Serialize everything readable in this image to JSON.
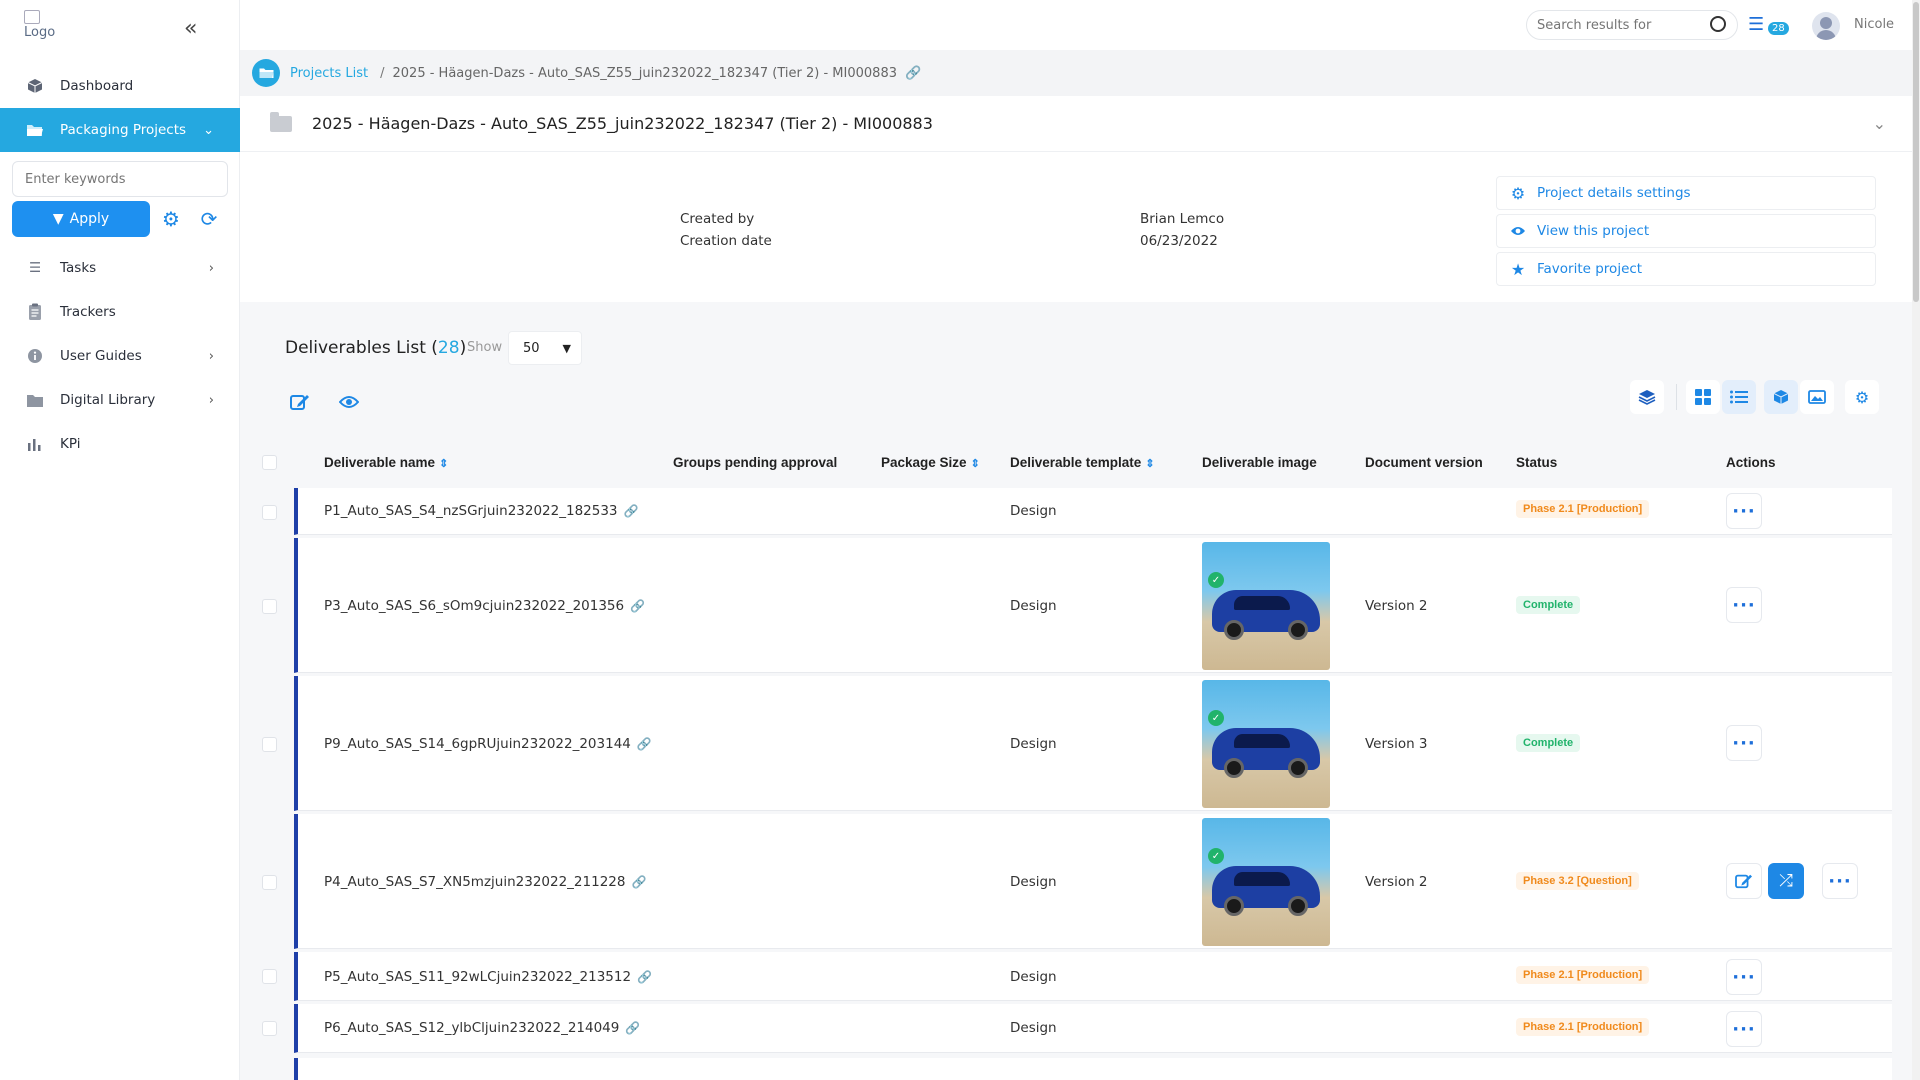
{
  "sidebar": {
    "logo_alt": "Logo",
    "items": [
      {
        "label": "Dashboard",
        "icon": "box-icon",
        "has_chevron": false
      },
      {
        "label": "Packaging Projects",
        "icon": "folder-open-icon",
        "has_chevron": true,
        "active": true
      },
      {
        "label": "Tasks",
        "icon": "list-icon",
        "has_chevron": true
      },
      {
        "label": "Trackers",
        "icon": "clipboard-icon",
        "has_chevron": false
      },
      {
        "label": "User Guides",
        "icon": "info-icon",
        "has_chevron": true
      },
      {
        "label": "Digital Library",
        "icon": "folder-icon",
        "has_chevron": true
      },
      {
        "label": "KPi",
        "icon": "bar-chart-icon",
        "has_chevron": false
      }
    ],
    "filter": {
      "placeholder": "Enter keywords",
      "apply_label": "Apply"
    }
  },
  "topbar": {
    "search_placeholder": "Search results for",
    "notification_count": "28",
    "username": "Nicole"
  },
  "breadcrumb": {
    "root": "Projects List",
    "separator": "/",
    "current": "2025 - Häagen-Dazs - Auto_SAS_Z55_juin232022_182347 (Tier 2) - MI000883"
  },
  "project": {
    "title": "2025 - Häagen-Dazs - Auto_SAS_Z55_juin232022_182347 (Tier 2) - MI000883",
    "created_by_label": "Created by",
    "created_by_value": "Brian Lemco",
    "creation_date_label": "Creation date",
    "creation_date_value": "06/23/2022",
    "actions": [
      {
        "label": "Project details settings",
        "icon": "gear-icon"
      },
      {
        "label": "View this project",
        "icon": "eye-icon"
      },
      {
        "label": "Favorite project",
        "icon": "star-icon"
      }
    ]
  },
  "deliverables": {
    "title": "Deliverables List",
    "count": "28",
    "show_label": "Show",
    "page_size": "50",
    "columns": [
      "Deliverable name",
      "Groups pending approval",
      "Package Size",
      "Deliverable template",
      "Deliverable image",
      "Document version",
      "Status",
      "Actions"
    ],
    "rows": [
      {
        "name": "P1_Auto_SAS_S4_nzSGrjuin232022_182533",
        "template": "Design",
        "version": "",
        "status": "Phase 2.1 [Production]",
        "status_type": "production",
        "has_image": false,
        "extra_actions": false
      },
      {
        "name": "P3_Auto_SAS_S6_sOm9cjuin232022_201356",
        "template": "Design",
        "version": "Version 2",
        "status": "Complete",
        "status_type": "complete",
        "has_image": true,
        "extra_actions": false
      },
      {
        "name": "P9_Auto_SAS_S14_6gpRUjuin232022_203144",
        "template": "Design",
        "version": "Version 3",
        "status": "Complete",
        "status_type": "complete",
        "has_image": true,
        "extra_actions": false
      },
      {
        "name": "P4_Auto_SAS_S7_XN5mzjuin232022_211228",
        "template": "Design",
        "version": "Version 2",
        "status": "Phase 3.2 [Question]",
        "status_type": "production",
        "has_image": true,
        "extra_actions": true
      },
      {
        "name": "P5_Auto_SAS_S11_92wLCjuin232022_213512",
        "template": "Design",
        "version": "",
        "status": "Phase 2.1 [Production]",
        "status_type": "production",
        "has_image": false,
        "extra_actions": false
      },
      {
        "name": "P6_Auto_SAS_S12_ylbCljuin232022_214049",
        "template": "Design",
        "version": "",
        "status": "Phase 2.1 [Production]",
        "status_type": "production",
        "has_image": false,
        "extra_actions": false
      }
    ]
  }
}
